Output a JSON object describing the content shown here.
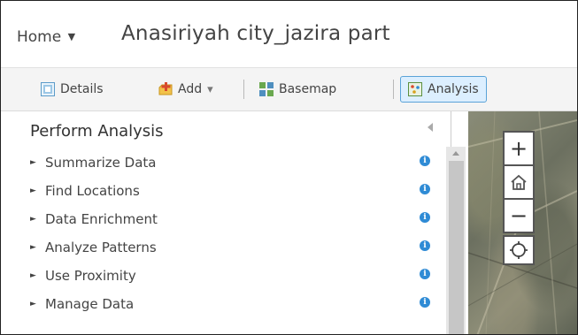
{
  "header": {
    "home_label": "Home",
    "home_caret": "▼",
    "map_title": "Anasiriyah city_jazira part"
  },
  "toolbar": {
    "details_label": "Details",
    "add_label": "Add",
    "add_caret": "▾",
    "basemap_label": "Basemap",
    "analysis_label": "Analysis"
  },
  "panel": {
    "title": "Perform Analysis",
    "items": [
      {
        "label": "Summarize Data"
      },
      {
        "label": "Find Locations"
      },
      {
        "label": "Data Enrichment"
      },
      {
        "label": "Analyze Patterns"
      },
      {
        "label": "Use Proximity"
      },
      {
        "label": "Manage Data"
      }
    ],
    "chevron": "►",
    "info_glyph": "i"
  },
  "map": {
    "zoom_in": "+",
    "home": "⌂",
    "zoom_out": "−"
  },
  "colors": {
    "accent": "#2f8bd5",
    "analysis_active_bg": "#dcefff",
    "analysis_active_border": "#5aa3d8"
  }
}
